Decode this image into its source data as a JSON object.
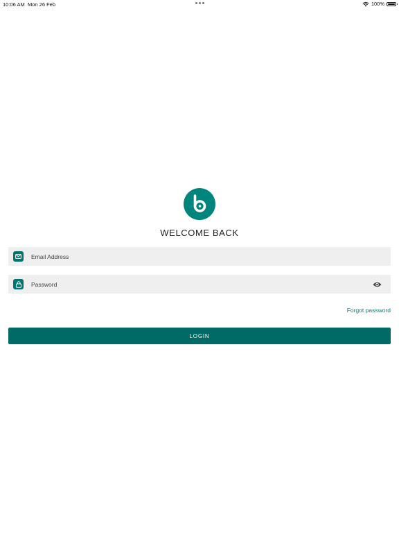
{
  "status_bar": {
    "time": "10:06 AM",
    "date": "Mon 26 Feb",
    "battery": "100%"
  },
  "header": {
    "title": "WELCOME BACK"
  },
  "form": {
    "email": {
      "placeholder": "Email Address",
      "value": "",
      "icon": "mail-icon"
    },
    "password": {
      "placeholder": "Password",
      "value": "",
      "icon": "lock-icon",
      "toggle_icon": "eye-icon"
    },
    "forgot_password_label": "Forgot password",
    "login_label": "LOGIN"
  },
  "colors": {
    "brand": "#00857c",
    "button": "#006b66",
    "link": "#0f7d77",
    "field_background": "#efefef"
  }
}
